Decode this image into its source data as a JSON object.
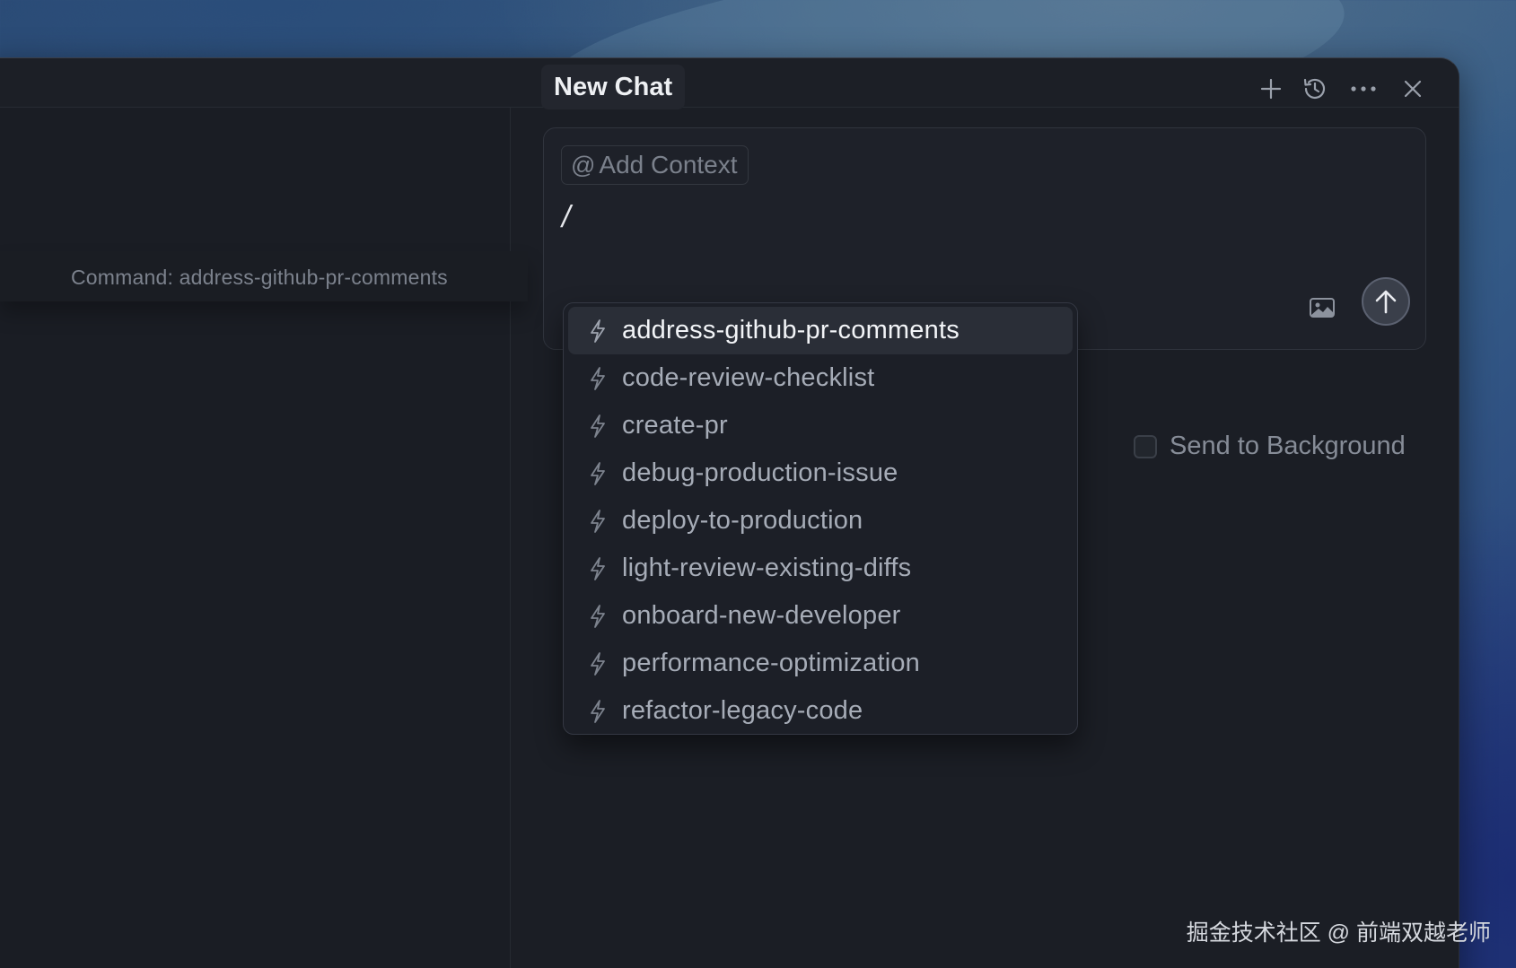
{
  "chat": {
    "title": "New Chat",
    "header_icons": [
      "plus-icon",
      "history-icon",
      "more-icon",
      "close-icon"
    ]
  },
  "tooltip": {
    "text": "Command: address-github-pr-comments"
  },
  "composer": {
    "add_context_at": "@",
    "add_context_label": "Add Context",
    "input_value": "/"
  },
  "background_option": {
    "label": "Send to Background",
    "checked": false
  },
  "command_menu": {
    "selected_index": 0,
    "items": [
      {
        "label": "address-github-pr-comments"
      },
      {
        "label": "code-review-checklist"
      },
      {
        "label": "create-pr"
      },
      {
        "label": "debug-production-issue"
      },
      {
        "label": "deploy-to-production"
      },
      {
        "label": "light-review-existing-diffs"
      },
      {
        "label": "onboard-new-developer"
      },
      {
        "label": "performance-optimization"
      },
      {
        "label": "refactor-legacy-code"
      }
    ]
  },
  "watermark": "掘金技术社区 @ 前端双越老师",
  "colors": {
    "window_bg": "#1b1e25",
    "selected_item_bg": "#2a2e37",
    "text_primary": "#eef0f3",
    "text_muted": "#7b818c"
  }
}
